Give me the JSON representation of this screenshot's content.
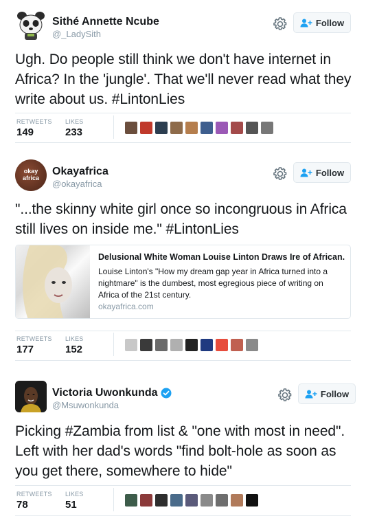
{
  "tweets": [
    {
      "name": "Sithé Annette Ncube",
      "handle": "@_LadySith",
      "follow_label": "Follow",
      "text": "Ugh. Do people still think we don't have internet in Africa? In the 'jungle'. That we'll never read what they write about us. #LintonLies",
      "retweets_label": "RETWEETS",
      "retweets": "149",
      "likes_label": "LIKES",
      "likes": "233",
      "liker_colors": [
        "#6b4e3d",
        "#c0392b",
        "#2c3e50",
        "#8e6b4a",
        "#b57e4d",
        "#3e5e8e",
        "#9b59b6",
        "#a34a4a",
        "#555555",
        "#777777"
      ]
    },
    {
      "name": "Okayafrica",
      "handle": "@okayafrica",
      "avatar_text": "okay africa",
      "follow_label": "Follow",
      "text": "\"...the skinny white girl once so incongruous in Africa still lives on inside me.\" #LintonLies",
      "card": {
        "title": "Delusional White Woman Louise Linton Draws Ire of African...",
        "description": "Louise Linton's \"How my dream gap year in Africa turned into a nightmare\" is the dumbest, most egregious piece of writing on Africa of the 21st century.",
        "domain": "okayafrica.com"
      },
      "retweets_label": "RETWEETS",
      "retweets": "177",
      "likes_label": "LIKES",
      "likes": "152",
      "liker_colors": [
        "#c8c8c8",
        "#3a3a3a",
        "#6a6a6a",
        "#b0b0b0",
        "#222222",
        "#1f3a80",
        "#e74c3c",
        "#c06050",
        "#8a8a8a"
      ]
    },
    {
      "name": "Victoria Uwonkunda",
      "handle": "@Msuwonkunda",
      "follow_label": "Follow",
      "text": "Picking #Zambia from list & \"one with most in need\". Left with her dad's words \"find bolt-hole as soon as you get there, somewhere to hide\"",
      "retweets_label": "RETWEETS",
      "retweets": "78",
      "likes_label": "LIKES",
      "likes": "51",
      "liker_colors": [
        "#3d5c4a",
        "#8b3a3a",
        "#2e2e2e",
        "#4a6b8a",
        "#5a5a7a",
        "#8a8a8a",
        "#6e6e6e",
        "#b07a5a",
        "#111111"
      ]
    }
  ],
  "colors": {
    "verified": "#1da1f2",
    "follow_icon": "#1da1f2",
    "muted": "#8899a6",
    "divider": "#e1e8ed"
  }
}
